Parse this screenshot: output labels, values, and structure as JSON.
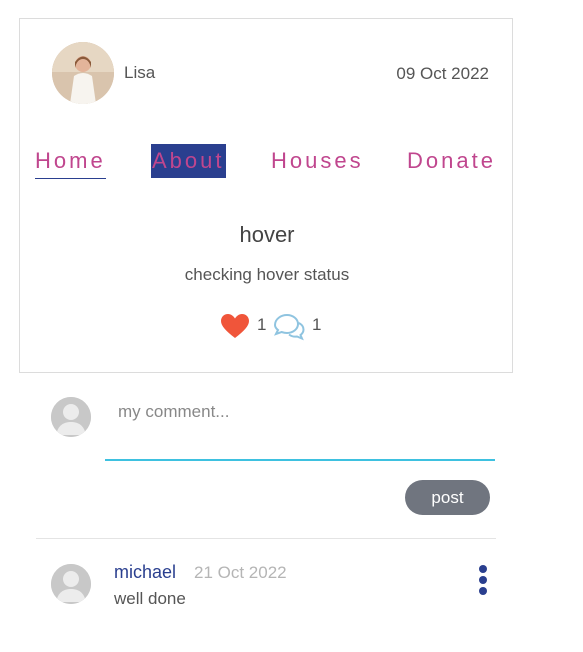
{
  "post": {
    "author": "Lisa",
    "date": "09 Oct 2022",
    "title": "hover",
    "body": "checking hover status",
    "likes": "1",
    "comments": "1"
  },
  "nav": {
    "items": [
      {
        "label": "Home",
        "state": "active"
      },
      {
        "label": "About",
        "state": "hover"
      },
      {
        "label": "Houses"
      },
      {
        "label": "Donate"
      }
    ]
  },
  "comment_form": {
    "placeholder": "my comment...",
    "submit_label": "post"
  },
  "comments": [
    {
      "author": "michael",
      "date": "21 Oct 2022",
      "text": "well done"
    }
  ],
  "colors": {
    "nav_text": "#c0468e",
    "nav_accent": "#2a3f8f",
    "heart": "#f0553a",
    "comment_icon": "#8fc4e0",
    "input_underline": "#3ec1e0",
    "post_button": "#70757f",
    "menu_dots": "#2a3f8f"
  },
  "icons": {
    "author_avatar": "author-avatar-photo",
    "like": "heart-icon",
    "comments": "speech-bubbles-icon",
    "user_avatar": "default-user-avatar-icon",
    "more": "vertical-ellipsis-icon"
  }
}
